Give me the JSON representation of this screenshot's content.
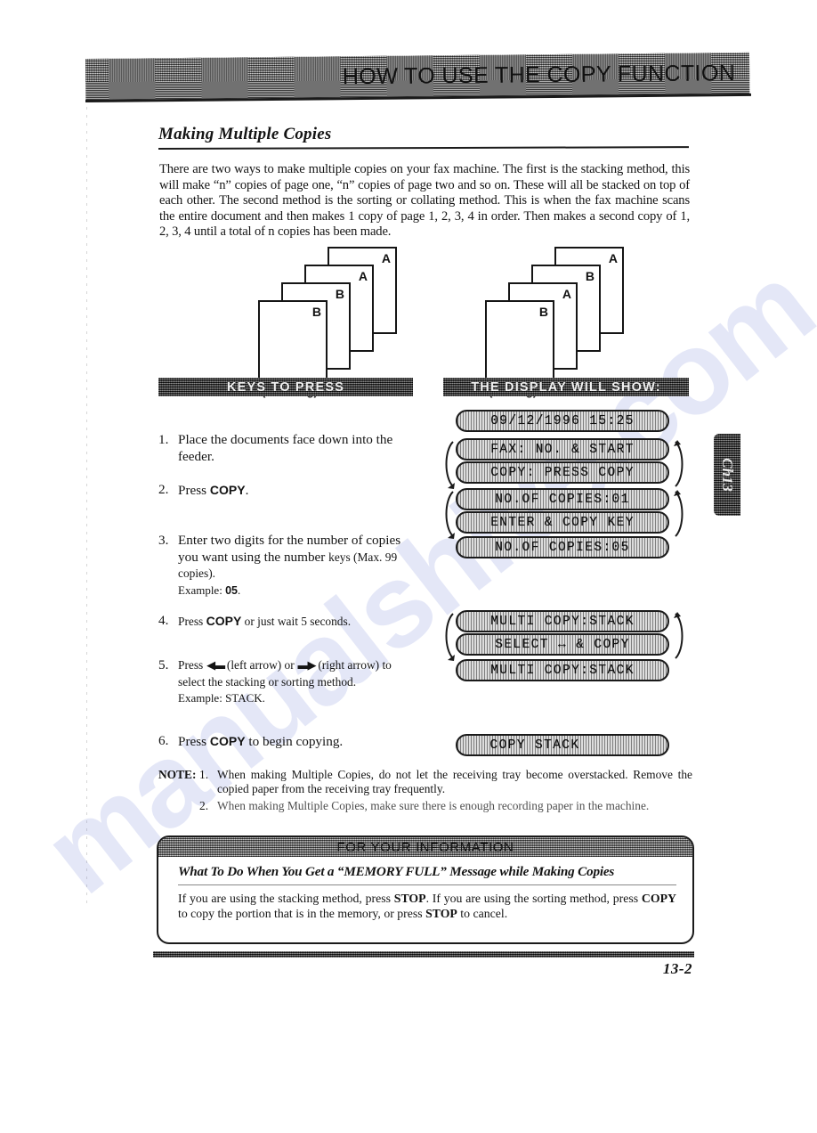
{
  "header": {
    "chapter_title": "HOW TO USE THE COPY FUNCTION",
    "chapter_tab": "Ch13"
  },
  "section": {
    "title": "Making Multiple Copies",
    "intro": "There are two ways to make multiple copies on your fax machine. The first is the stacking method, this will make “n” copies of page one, “n” copies of page two and so on. These will all be stacked on top of each other. The second method is the sorting or collating method. This is when the fax machine scans the entire document and then makes 1 copy of page 1, 2, 3, 4 in order. Then makes a second copy of 1, 2, 3, 4 until a total of n copies has been made."
  },
  "diagrams": {
    "stacking": {
      "caption": "(Stacking)",
      "sheet_labels": [
        "A",
        "A",
        "B",
        "B"
      ]
    },
    "sorting": {
      "caption": "(Sorting)",
      "sheet_labels": [
        "A",
        "B",
        "A",
        "B"
      ]
    }
  },
  "columns": {
    "keys_to_press": "KEYS TO PRESS",
    "display_will_show": "THE DISPLAY WILL SHOW:"
  },
  "steps": [
    {
      "num": "1.",
      "text": "Place the documents face down into the feeder."
    },
    {
      "num": "2.",
      "text": "Press COPY."
    },
    {
      "num": "3.",
      "text": "Enter two digits for the number of copies you want using the number keys (Max. 99 copies).",
      "example": "Example: 05."
    },
    {
      "num": "4.",
      "text": "Press COPY or just wait 5 seconds."
    },
    {
      "num": "5.",
      "text": "Press ◀ (left arrow) or ▶ (right arrow) to select the stacking or sorting method.",
      "example": "Example: STACK."
    },
    {
      "num": "6.",
      "text": "Press COPY to begin copying."
    }
  ],
  "displays": [
    {
      "id": "datetime",
      "text": "09/12/1996 15:25"
    },
    {
      "id": "fax-start",
      "text": "FAX: NO. & START"
    },
    {
      "id": "copy-press",
      "text": "COPY: PRESS COPY"
    },
    {
      "id": "copies-01",
      "text": "NO.OF COPIES:01"
    },
    {
      "id": "enter-copy",
      "text": "ENTER & COPY KEY"
    },
    {
      "id": "copies-05",
      "text": "NO.OF COPIES:05"
    },
    {
      "id": "multi-stack-1",
      "text": "MULTI COPY:STACK"
    },
    {
      "id": "select-copy",
      "text": "SELECT ↔ & COPY"
    },
    {
      "id": "multi-stack-2",
      "text": "MULTI COPY:STACK"
    },
    {
      "id": "copy-stack",
      "text": "COPY STACK"
    }
  ],
  "note": {
    "label": "NOTE:",
    "items": [
      {
        "idx": "1.",
        "text": "When making Multiple Copies, do not let the receiving tray become overstacked. Remove the copied paper from the receiving tray frequently."
      },
      {
        "idx": "2.",
        "text": "When making Multiple Copies, make sure there is enough recording paper in the machine."
      }
    ]
  },
  "fyi": {
    "heading": "FOR YOUR INFORMATION",
    "subheading": "What To Do When You Get a “MEMORY FULL” Message while Making Copies",
    "body": "If you are using the stacking method, press STOP. If you are using the sorting method, press COPY to copy the portion that is in the memory, or press STOP to cancel."
  },
  "footer": {
    "page_number": "13-2"
  },
  "watermark": {
    "text": "manualshive.com"
  },
  "colors": {
    "ink": "#141414",
    "band": "#8e8e8e",
    "band_dark": "#2a2a2a",
    "lcd": "#b4b4b4",
    "watermark": "#7686d6"
  }
}
